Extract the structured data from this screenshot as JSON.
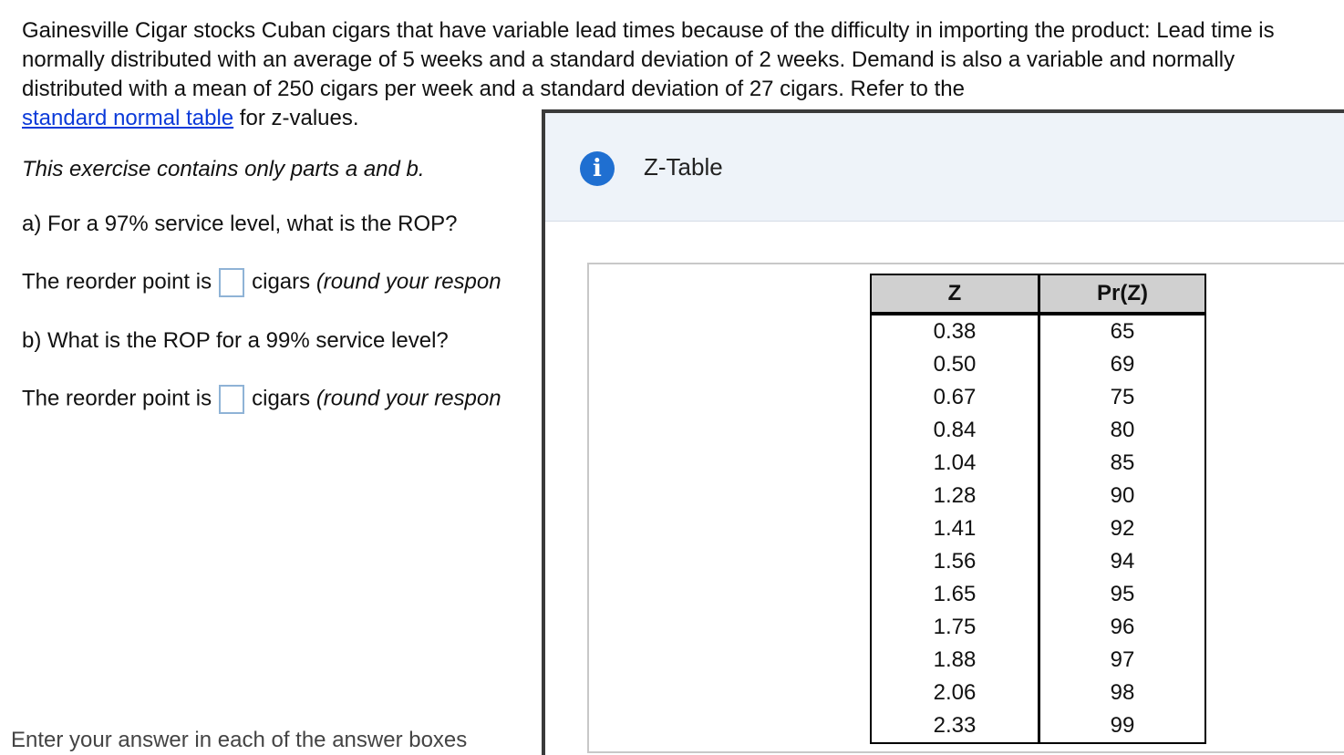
{
  "problem": {
    "text": "Gainesville Cigar stocks Cuban cigars that have variable lead times because of the difficulty in importing the product: Lead time is normally distributed with an average of 5 weeks and a standard deviation of 2 weeks. Demand is also a variable and normally distributed with a mean of 250 cigars per week and a standard deviation of 27 cigars. Refer to the",
    "link": "standard normal table",
    "after_link": " for z-values."
  },
  "note": "This exercise contains only parts a and b.",
  "part_a": {
    "question": "a) For a 97% service level, what is the ROP?",
    "prefix": "The reorder point is",
    "suffix": "cigars",
    "hint": "(round your respon"
  },
  "part_b": {
    "question": "b) What is the ROP for a 99% service level?",
    "prefix": "The reorder point is",
    "suffix": "cigars",
    "hint": "(round your respon"
  },
  "footer": "Enter your answer in each of the answer boxes",
  "popup": {
    "icon": "info-icon",
    "title": "Z-Table",
    "headers": [
      "Z",
      "Pr(Z)"
    ],
    "rows": [
      [
        "0.38",
        "65"
      ],
      [
        "0.50",
        "69"
      ],
      [
        "0.67",
        "75"
      ],
      [
        "0.84",
        "80"
      ],
      [
        "1.04",
        "85"
      ],
      [
        "1.28",
        "90"
      ],
      [
        "1.41",
        "92"
      ],
      [
        "1.56",
        "94"
      ],
      [
        "1.65",
        "95"
      ],
      [
        "1.75",
        "96"
      ],
      [
        "1.88",
        "97"
      ],
      [
        "2.06",
        "98"
      ],
      [
        "2.33",
        "99"
      ]
    ]
  },
  "colors": {
    "link": "#0b3ad9",
    "info_icon": "#1f6fd1",
    "popup_header_bg": "#eef3f9",
    "table_header_bg": "#d0d0d0"
  }
}
